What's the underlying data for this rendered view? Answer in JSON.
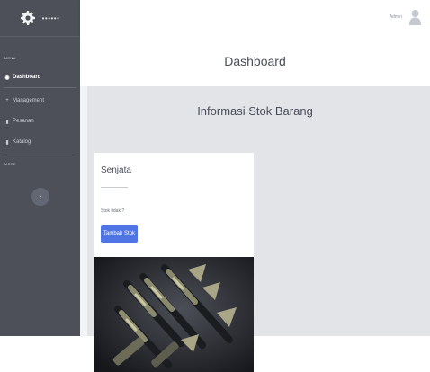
{
  "sidebar": {
    "brand_icon": "gear-icon",
    "brand_text": "••••••",
    "heading_main": "MENU",
    "items": [
      {
        "label": "Dashboard",
        "icon": "dashboard-icon",
        "active": true
      },
      {
        "label": "Management",
        "icon": "plus-icon",
        "active": false
      },
      {
        "label": "Pesanan",
        "icon": "list-icon",
        "active": false
      },
      {
        "label": "Katalog",
        "icon": "list-icon",
        "active": false
      }
    ],
    "heading_more": "MORE",
    "toggle_icon": "chevron-left-icon"
  },
  "topbar": {
    "user_name": "Admin",
    "avatar_icon": "user-avatar-icon"
  },
  "page": {
    "title": "Dashboard",
    "section_title": "Informasi Stok Barang"
  },
  "card": {
    "title": "Senjata",
    "stock_text": "Stok tidak ?",
    "button_label": "Tambah Stok",
    "image": "product-image"
  },
  "colors": {
    "sidebar_bg": "#4d5059",
    "button_primary": "#4f74e3",
    "content_bg": "#e2e4e8"
  }
}
